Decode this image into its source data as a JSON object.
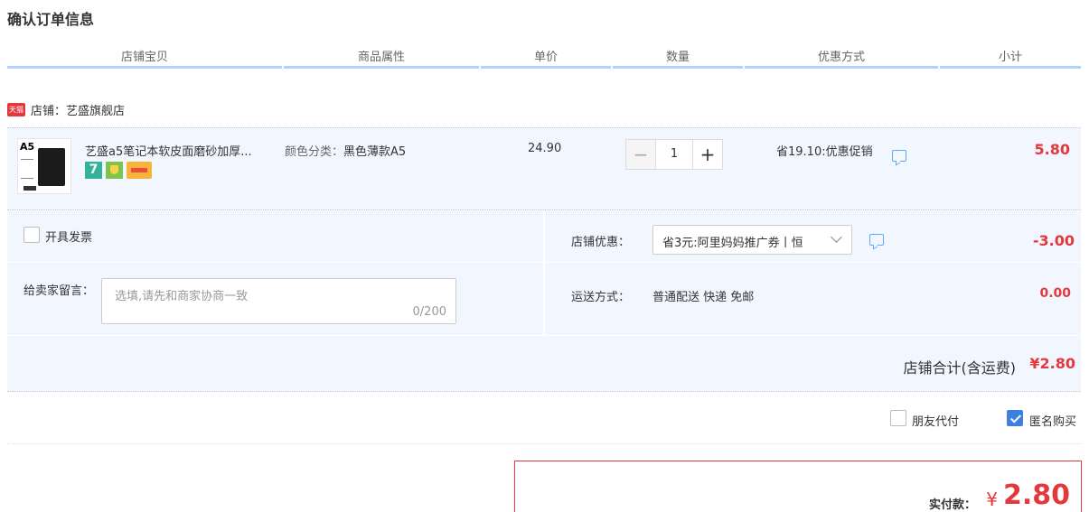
{
  "page": {
    "title": "确认订单信息"
  },
  "table_header": [
    "店铺宝贝",
    "商品属性",
    "单价",
    "数量",
    "优惠方式",
    "小计"
  ],
  "shop": {
    "badge": "天猫",
    "label": "店铺：艺盛旗舰店"
  },
  "item": {
    "title": "艺盛a5笔记本软皮面磨砂加厚...",
    "thumb_text": "A5",
    "attr_label": "颜色分类：",
    "attr_value": "黑色薄款A5",
    "price": "24.90",
    "minus": "−",
    "plus": "+",
    "quantity": "1",
    "promo": "省19.10:优惠促销",
    "subtotal": "5.80",
    "service_icons": [
      "seven-day-return-icon",
      "guarantee-icon",
      "credit-card-icon"
    ]
  },
  "invoice": {
    "label": "开具发票"
  },
  "message": {
    "label": "给卖家留言：",
    "placeholder": "选填,请先和商家协商一致",
    "count": "0/200"
  },
  "coupon": {
    "label": "店铺优惠：",
    "selected": "省3元:阿里妈妈推广券丨恒",
    "amount": "-3.00"
  },
  "shipping": {
    "label": "运送方式：",
    "value": "普通配送 快递 免邮",
    "fee": "0.00"
  },
  "shop_total": {
    "label": "店铺合计(含运费)",
    "value": "¥2.80"
  },
  "options": {
    "friend_pay": "朋友代付",
    "anonymous": "匿名购买",
    "anonymous_checked": true
  },
  "payment": {
    "label": "实付款：",
    "currency": "¥",
    "amount": "2.80"
  },
  "colors": {
    "accent_red": "#e4393c",
    "header_line": "#b2d1ff",
    "row_bg": "#f2f7ff",
    "check_blue": "#3d80e0"
  }
}
